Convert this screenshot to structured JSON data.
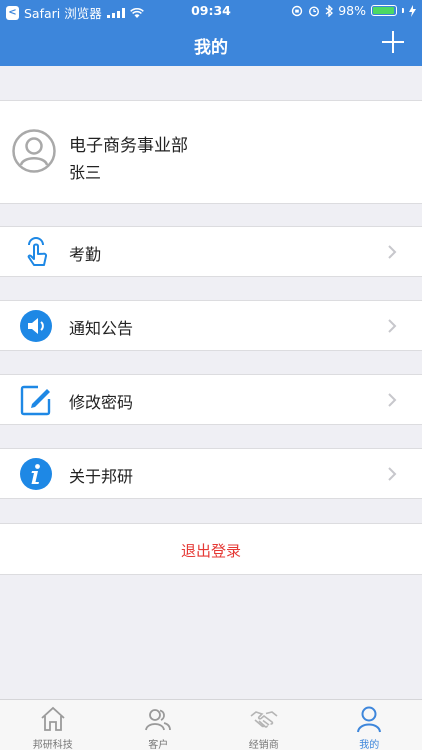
{
  "status_bar": {
    "carrier": "Safari 浏览器",
    "time": "09:34",
    "battery": "98%"
  },
  "nav": {
    "title": "我的",
    "add_icon": "plus-icon"
  },
  "profile": {
    "department": "电子商务事业部",
    "name": "张三",
    "avatar_icon": "user-outline-icon"
  },
  "menu": [
    {
      "label": "考勤",
      "icon": "tap-finger-icon"
    },
    {
      "label": "通知公告",
      "icon": "speaker-icon"
    },
    {
      "label": "修改密码",
      "icon": "edit-icon"
    },
    {
      "label": "关于邦研",
      "icon": "info-icon"
    }
  ],
  "logout_label": "退出登录",
  "tabs": [
    {
      "label": "邦研科技",
      "icon": "home-icon",
      "active": false
    },
    {
      "label": "客户",
      "icon": "customers-icon",
      "active": false
    },
    {
      "label": "经销商",
      "icon": "handshake-icon",
      "active": false
    },
    {
      "label": "我的",
      "icon": "person-icon",
      "active": true
    }
  ],
  "colors": {
    "primary": "#3d86db",
    "background": "#efeff4",
    "logout_text": "#e53935",
    "battery": "#4cd964"
  }
}
